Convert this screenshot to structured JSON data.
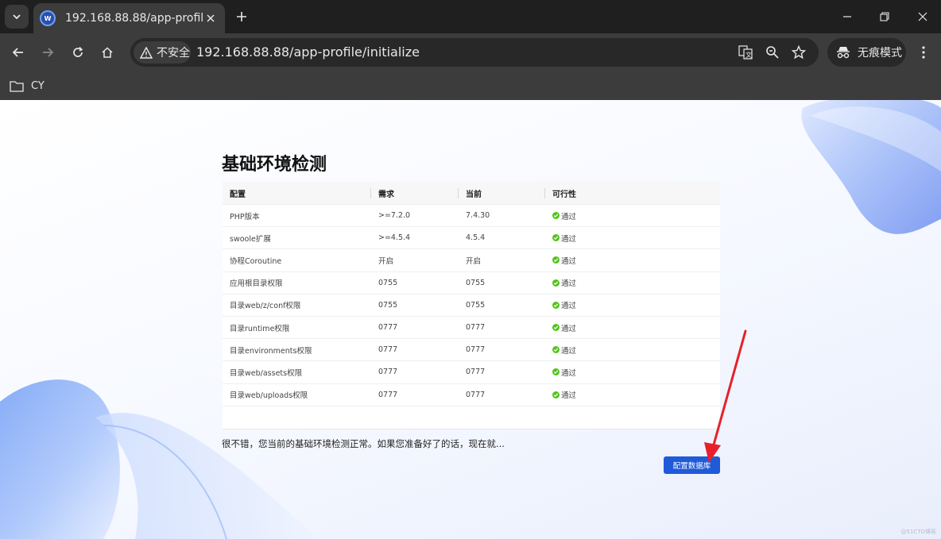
{
  "browser": {
    "tab_title": "192.168.88.88/app-profile",
    "favicon_text": "W",
    "security_label": "不安全",
    "url": "192.168.88.88/app-profile/initialize",
    "incognito_label": "无痕模式",
    "bookmarks": [
      {
        "label": "CY"
      }
    ]
  },
  "page": {
    "title": "基础环境检测",
    "table": {
      "headers": [
        "配置",
        "需求",
        "当前",
        "可行性"
      ],
      "rows": [
        {
          "config": "PHP版本",
          "required": ">=7.2.0",
          "current": "7.4.30",
          "status": "通过"
        },
        {
          "config": "swoole扩展",
          "required": ">=4.5.4",
          "current": "4.5.4",
          "status": "通过"
        },
        {
          "config": "协程Coroutine",
          "required": "开启",
          "current": "开启",
          "status": "通过"
        },
        {
          "config": "应用根目录权限",
          "required": "0755",
          "current": "0755",
          "status": "通过"
        },
        {
          "config": "目录web/z/conf权限",
          "required": "0755",
          "current": "0755",
          "status": "通过"
        },
        {
          "config": "目录runtime权限",
          "required": "0777",
          "current": "0777",
          "status": "通过"
        },
        {
          "config": "目录environments权限",
          "required": "0777",
          "current": "0777",
          "status": "通过"
        },
        {
          "config": "目录web/assets权限",
          "required": "0777",
          "current": "0777",
          "status": "通过"
        },
        {
          "config": "目录web/uploads权限",
          "required": "0777",
          "current": "0777",
          "status": "通过"
        }
      ]
    },
    "message": "很不错，您当前的基础环境检测正常。如果您准备好了的话，现在就...",
    "next_button": "配置数据库",
    "watermark": "@51CTO博客"
  },
  "colors": {
    "primary": "#1f5ad8",
    "success": "#52c41a",
    "annotation_arrow": "#e8202a"
  }
}
